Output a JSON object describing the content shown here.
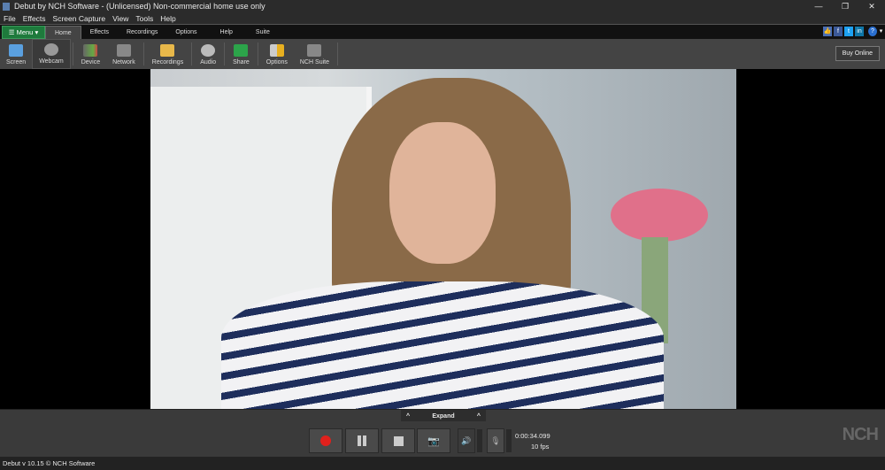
{
  "title": "Debut by NCH Software - (Unlicensed) Non-commercial home use only",
  "menubar": [
    "File",
    "Effects",
    "Screen Capture",
    "View",
    "Tools",
    "Help"
  ],
  "menu_button": "Menu",
  "tabs": [
    "Home",
    "Effects",
    "Recordings",
    "Options",
    "Help",
    "Suite"
  ],
  "toolbar": [
    "Screen",
    "Webcam",
    "Device",
    "Network",
    "Recordings",
    "Audio",
    "Share",
    "Options",
    "NCH Suite"
  ],
  "buy_online": "Buy Online",
  "expand": "Expand",
  "time": "0:00:34.099",
  "fps": "10 fps",
  "status": "Debut v 10.15 © NCH Software",
  "logo": "NCH Software",
  "colors": {
    "menu_green": "#1e7a3c",
    "record_red": "#e0201c"
  }
}
